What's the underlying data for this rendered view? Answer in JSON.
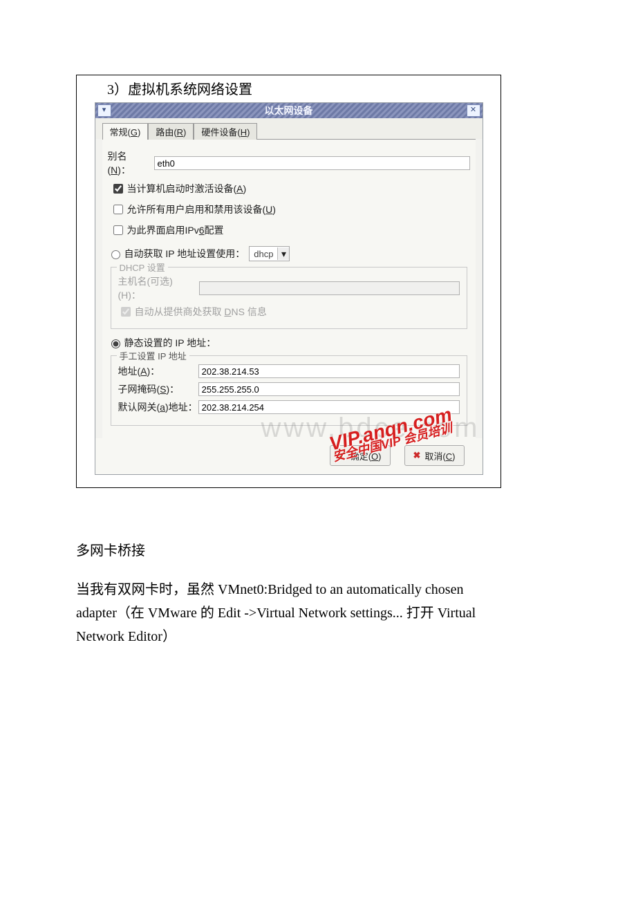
{
  "section_heading": "3）虚拟机系统网络设置",
  "dialog": {
    "title": "以太网设备",
    "tabs": {
      "general": "常规(G)",
      "route": "路由(R)",
      "hardware": "硬件设备(H)"
    },
    "alias_label": "别名(N)：",
    "alias_value": "eth0",
    "checks": {
      "activate_on_boot": "当计算机启动时激活设备(A)",
      "allow_all_users": "允许所有用户启用和禁用该设备(U)",
      "enable_ipv6": "为此界面启用IPv6配置"
    },
    "auto_ip_label": "自动获取 IP 地址设置使用：",
    "auto_ip_select": "dhcp",
    "dhcp": {
      "legend": "DHCP 设置",
      "hostname_label": "主机名(可选)(H)：",
      "hostname_value": "",
      "auto_dns": "自动从提供商处获取 DNS 信息"
    },
    "static_label": "静态设置的 IP 地址：",
    "manual": {
      "legend": "手工设置 IP 地址",
      "address_label": "地址(A)：",
      "address_value": "202.38.214.53",
      "netmask_label": "子网掩码(S)：",
      "netmask_value": "255.255.255.0",
      "gateway_label": "默认网关(a)地址：",
      "gateway_value": "202.38.214.254"
    },
    "buttons": {
      "ok": "确定(O)",
      "cancel": "取消(C)"
    }
  },
  "watermarks": {
    "gray": "www.bdce.com",
    "red_line1": "VIP.anqn.com",
    "red_line2": "安全中国VIP 会员培训"
  },
  "below_heading": "多网卡桥接",
  "below_text": "当我有双网卡时，虽然 VMnet0:Bridged to an automatically chosen adapter（在 VMware 的 Edit ->Virtual Network settings... 打开 Virtual Network Editor）"
}
